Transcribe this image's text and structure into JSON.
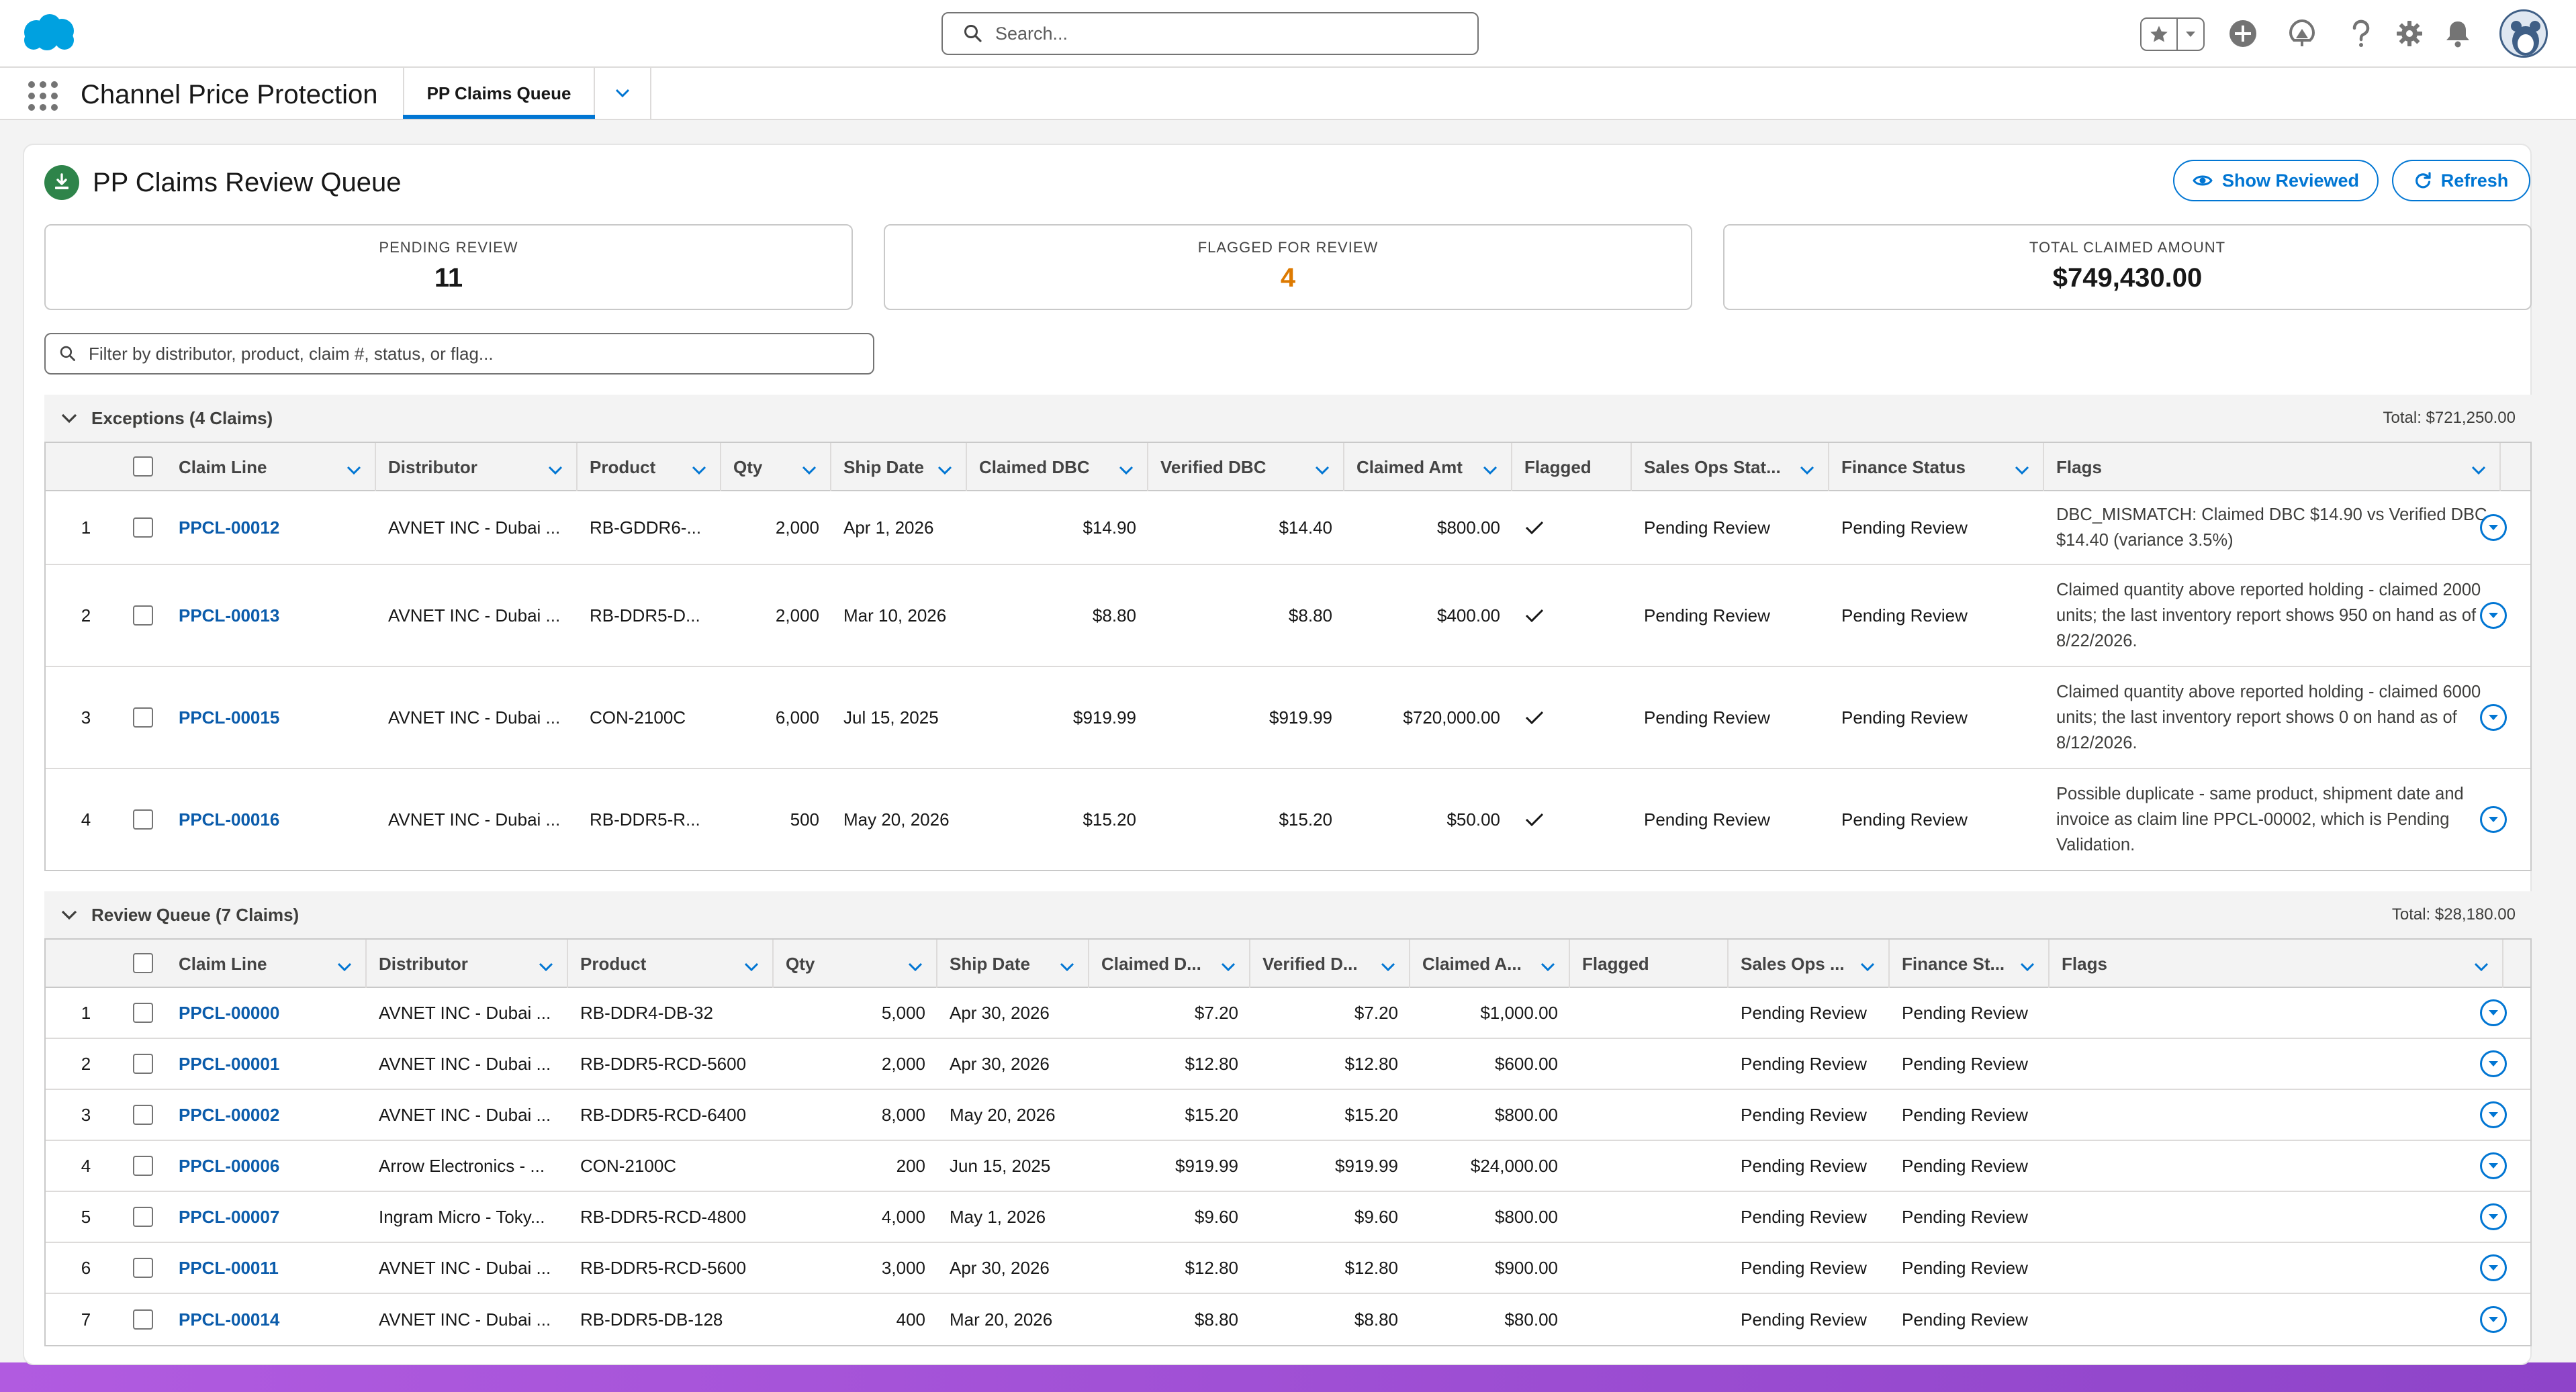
{
  "global_header": {
    "search_placeholder": "Search..."
  },
  "app_nav": {
    "app_name": "Channel Price Protection",
    "active_tab": "PP Claims Queue"
  },
  "page": {
    "title": "PP Claims Review Queue",
    "buttons": {
      "show_reviewed": "Show Reviewed",
      "refresh": "Refresh"
    },
    "stats": [
      {
        "label": "PENDING REVIEW",
        "value": "11"
      },
      {
        "label": "FLAGGED FOR REVIEW",
        "value": "4",
        "color": "#dd7a01"
      },
      {
        "label": "TOTAL CLAIMED AMOUNT",
        "value": "$749,430.00"
      }
    ],
    "filter_placeholder": "Filter by distributor, product, claim #, status, or flag..."
  },
  "exceptions": {
    "title": "Exceptions (4 Claims)",
    "total": "Total: $721,250.00",
    "columns": [
      "Claim Line",
      "Distributor",
      "Product",
      "Qty",
      "Ship Date",
      "Claimed DBC",
      "Verified DBC",
      "Claimed Amt",
      "Flagged",
      "Sales Ops Stat...",
      "Finance Status",
      "Flags"
    ],
    "rows": [
      {
        "n": "1",
        "claim": "PPCL-00012",
        "distributor": "AVNET INC - Dubai ...",
        "product": "RB-GDDR6-...",
        "qty": "2,000",
        "ship": "Apr 1, 2026",
        "cdbc": "$14.90",
        "vdbc": "$14.40",
        "amt": "$800.00",
        "sales": "Pending Review",
        "finance": "Pending Review",
        "flags": "DBC_MISMATCH: Claimed DBC $14.90 vs Verified DBC $14.40 (variance 3.5%)"
      },
      {
        "n": "2",
        "claim": "PPCL-00013",
        "distributor": "AVNET INC - Dubai ...",
        "product": "RB-DDR5-D...",
        "qty": "2,000",
        "ship": "Mar 10, 2026",
        "cdbc": "$8.80",
        "vdbc": "$8.80",
        "amt": "$400.00",
        "sales": "Pending Review",
        "finance": "Pending Review",
        "flags": "Claimed quantity above reported holding - claimed 2000 units; the last inventory report shows 950 on hand as of 8/22/2026."
      },
      {
        "n": "3",
        "claim": "PPCL-00015",
        "distributor": "AVNET INC - Dubai ...",
        "product": "CON-2100C",
        "qty": "6,000",
        "ship": "Jul 15, 2025",
        "cdbc": "$919.99",
        "vdbc": "$919.99",
        "amt": "$720,000.00",
        "sales": "Pending Review",
        "finance": "Pending Review",
        "flags": "Claimed quantity above reported holding - claimed 6000 units; the last inventory report shows 0 on hand as of 8/12/2026."
      },
      {
        "n": "4",
        "claim": "PPCL-00016",
        "distributor": "AVNET INC - Dubai ...",
        "product": "RB-DDR5-R...",
        "qty": "500",
        "ship": "May 20, 2026",
        "cdbc": "$15.20",
        "vdbc": "$15.20",
        "amt": "$50.00",
        "sales": "Pending Review",
        "finance": "Pending Review",
        "flags": "Possible duplicate - same product, shipment date and invoice as claim line PPCL-00002, which is Pending Validation."
      }
    ]
  },
  "review_queue": {
    "title": "Review Queue (7 Claims)",
    "total": "Total: $28,180.00",
    "columns": [
      "Claim Line",
      "Distributor",
      "Product",
      "Qty",
      "Ship Date",
      "Claimed D...",
      "Verified D...",
      "Claimed A...",
      "Flagged",
      "Sales Ops ...",
      "Finance St...",
      "Flags"
    ],
    "rows": [
      {
        "n": "1",
        "claim": "PPCL-00000",
        "distributor": "AVNET INC - Dubai ...",
        "product": "RB-DDR4-DB-32",
        "qty": "5,000",
        "ship": "Apr 30, 2026",
        "cdbc": "$7.20",
        "vdbc": "$7.20",
        "amt": "$1,000.00",
        "sales": "Pending Review",
        "finance": "Pending Review"
      },
      {
        "n": "2",
        "claim": "PPCL-00001",
        "distributor": "AVNET INC - Dubai ...",
        "product": "RB-DDR5-RCD-5600",
        "qty": "2,000",
        "ship": "Apr 30, 2026",
        "cdbc": "$12.80",
        "vdbc": "$12.80",
        "amt": "$600.00",
        "sales": "Pending Review",
        "finance": "Pending Review"
      },
      {
        "n": "3",
        "claim": "PPCL-00002",
        "distributor": "AVNET INC - Dubai ...",
        "product": "RB-DDR5-RCD-6400",
        "qty": "8,000",
        "ship": "May 20, 2026",
        "cdbc": "$15.20",
        "vdbc": "$15.20",
        "amt": "$800.00",
        "sales": "Pending Review",
        "finance": "Pending Review"
      },
      {
        "n": "4",
        "claim": "PPCL-00006",
        "distributor": "Arrow Electronics - ...",
        "product": "CON-2100C",
        "qty": "200",
        "ship": "Jun 15, 2025",
        "cdbc": "$919.99",
        "vdbc": "$919.99",
        "amt": "$24,000.00",
        "sales": "Pending Review",
        "finance": "Pending Review"
      },
      {
        "n": "5",
        "claim": "PPCL-00007",
        "distributor": "Ingram Micro - Toky...",
        "product": "RB-DDR5-RCD-4800",
        "qty": "4,000",
        "ship": "May 1, 2026",
        "cdbc": "$9.60",
        "vdbc": "$9.60",
        "amt": "$800.00",
        "sales": "Pending Review",
        "finance": "Pending Review"
      },
      {
        "n": "6",
        "claim": "PPCL-00011",
        "distributor": "AVNET INC - Dubai ...",
        "product": "RB-DDR5-RCD-5600",
        "qty": "3,000",
        "ship": "Apr 30, 2026",
        "cdbc": "$12.80",
        "vdbc": "$12.80",
        "amt": "$900.00",
        "sales": "Pending Review",
        "finance": "Pending Review"
      },
      {
        "n": "7",
        "claim": "PPCL-00014",
        "distributor": "AVNET INC - Dubai ...",
        "product": "RB-DDR5-DB-128",
        "qty": "400",
        "ship": "Mar 20, 2026",
        "cdbc": "$8.80",
        "vdbc": "$8.80",
        "amt": "$80.00",
        "sales": "Pending Review",
        "finance": "Pending Review"
      }
    ]
  },
  "colors": {
    "brand_blue": "#0176d3",
    "link_blue": "#0b5cab",
    "flag_orange": "#dd7a01",
    "title_icon_green": "#2e844a"
  }
}
